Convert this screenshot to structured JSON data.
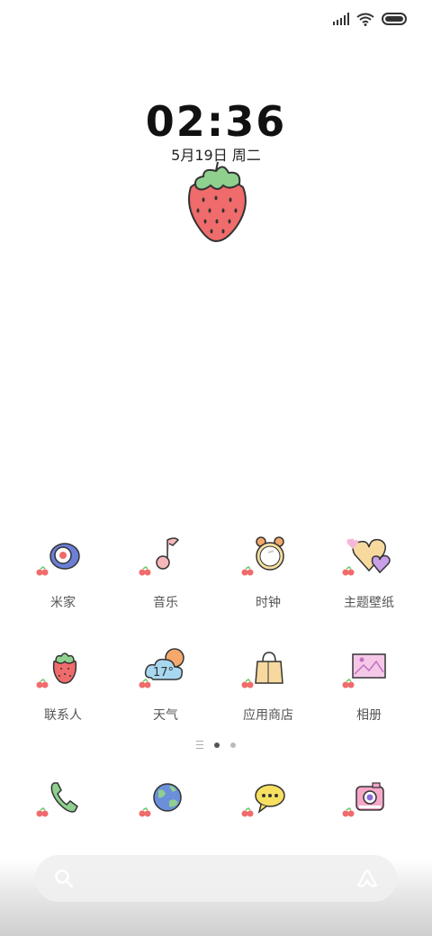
{
  "lockscreen": {
    "time": "02:36",
    "date": "5月19日 周二"
  },
  "apps_row1": [
    {
      "label": "米家",
      "icon": "mijia-icon"
    },
    {
      "label": "音乐",
      "icon": "music-icon"
    },
    {
      "label": "时钟",
      "icon": "alarm-clock-icon"
    },
    {
      "label": "主题壁纸",
      "icon": "hearts-theme-icon"
    }
  ],
  "apps_row2": [
    {
      "label": "联系人",
      "icon": "strawberry-contact-icon"
    },
    {
      "label": "天气",
      "icon": "weather-cloud-icon",
      "temp": "17°"
    },
    {
      "label": "应用商店",
      "icon": "shopping-bag-icon"
    },
    {
      "label": "相册",
      "icon": "photo-frame-icon"
    }
  ],
  "dock": [
    {
      "icon": "phone-icon"
    },
    {
      "icon": "globe-browser-icon"
    },
    {
      "icon": "message-bubble-icon"
    },
    {
      "icon": "camera-icon"
    }
  ],
  "search": {
    "left_icon": "search-icon",
    "right_icon": "assistant-icon"
  },
  "colors": {
    "strawberry": "#f06b6b",
    "leaf": "#8fd08f",
    "accent": "#c89bd8"
  }
}
